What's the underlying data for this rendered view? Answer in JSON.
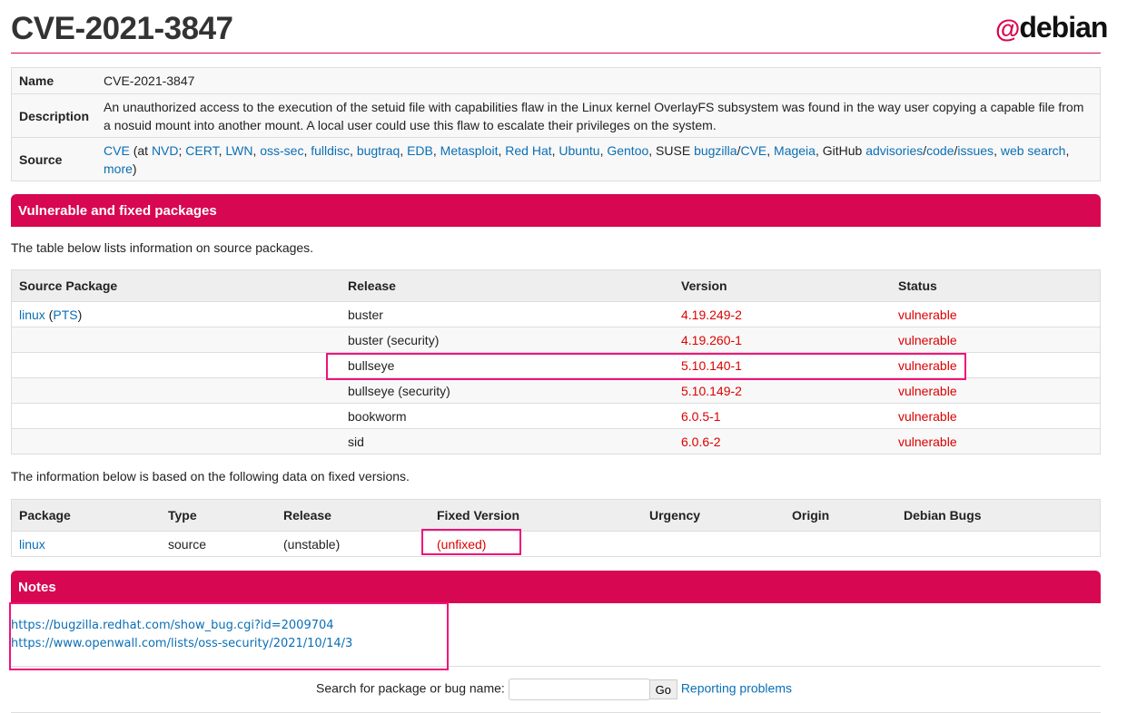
{
  "title": "CVE-2021-3847",
  "logo": "debian",
  "info": {
    "name_label": "Name",
    "name": "CVE-2021-3847",
    "desc_label": "Description",
    "desc": "An unauthorized access to the execution of the setuid file with capabilities flaw in the Linux kernel OverlayFS subsystem was found in the way user copying a capable file from a nosuid mount into another mount. A local user could use this flaw to escalate their privileges on the system.",
    "source_label": "Source",
    "source": [
      "CVE",
      " (at ",
      "NVD",
      "; ",
      "CERT",
      ", ",
      "LWN",
      ", ",
      "oss-sec",
      ", ",
      "fulldisc",
      ", ",
      "bugtraq",
      ", ",
      "EDB",
      ", ",
      "Metasploit",
      ", ",
      "Red Hat",
      ", ",
      "Ubuntu",
      ", ",
      "Gentoo",
      ", SUSE ",
      "bugzilla",
      "/",
      "CVE",
      ", ",
      "Mageia",
      ", GitHub ",
      "advisories",
      "/",
      "code",
      "/",
      "issues",
      ", ",
      "web search",
      ", ",
      "more",
      ")"
    ]
  },
  "vuln_section": "Vulnerable and fixed packages",
  "vuln_intro": "The table below lists information on source packages.",
  "vuln_table": {
    "headers": [
      "Source Package",
      "Release",
      "Version",
      "Status"
    ],
    "pkg": "linux",
    "pts": "PTS",
    "rows": [
      [
        "buster",
        "4.19.249-2",
        "vulnerable"
      ],
      [
        "buster (security)",
        "4.19.260-1",
        "vulnerable"
      ],
      [
        "bullseye",
        "5.10.140-1",
        "vulnerable"
      ],
      [
        "bullseye (security)",
        "5.10.149-2",
        "vulnerable"
      ],
      [
        "bookworm",
        "6.0.5-1",
        "vulnerable"
      ],
      [
        "sid",
        "6.0.6-2",
        "vulnerable"
      ]
    ]
  },
  "fixed_intro": "The information below is based on the following data on fixed versions.",
  "fixed_table": {
    "headers": [
      "Package",
      "Type",
      "Release",
      "Fixed Version",
      "Urgency",
      "Origin",
      "Debian Bugs"
    ],
    "row": [
      "linux",
      "source",
      "(unstable)",
      "(unfixed)",
      "",
      "",
      ""
    ]
  },
  "notes_section": "Notes",
  "notes": [
    "https://bugzilla.redhat.com/show_bug.cgi?id=2009704",
    "https://www.openwall.com/lists/oss-security/2021/10/14/3"
  ],
  "footer": {
    "search_label": "Search for package or bug name:",
    "search_value": "",
    "go": "Go",
    "report": "Reporting problems"
  },
  "colors": {
    "accent": "#d70751",
    "highlight": "#f0127a",
    "link": "#0b6fb5",
    "vulnerable": "#dd0000"
  }
}
